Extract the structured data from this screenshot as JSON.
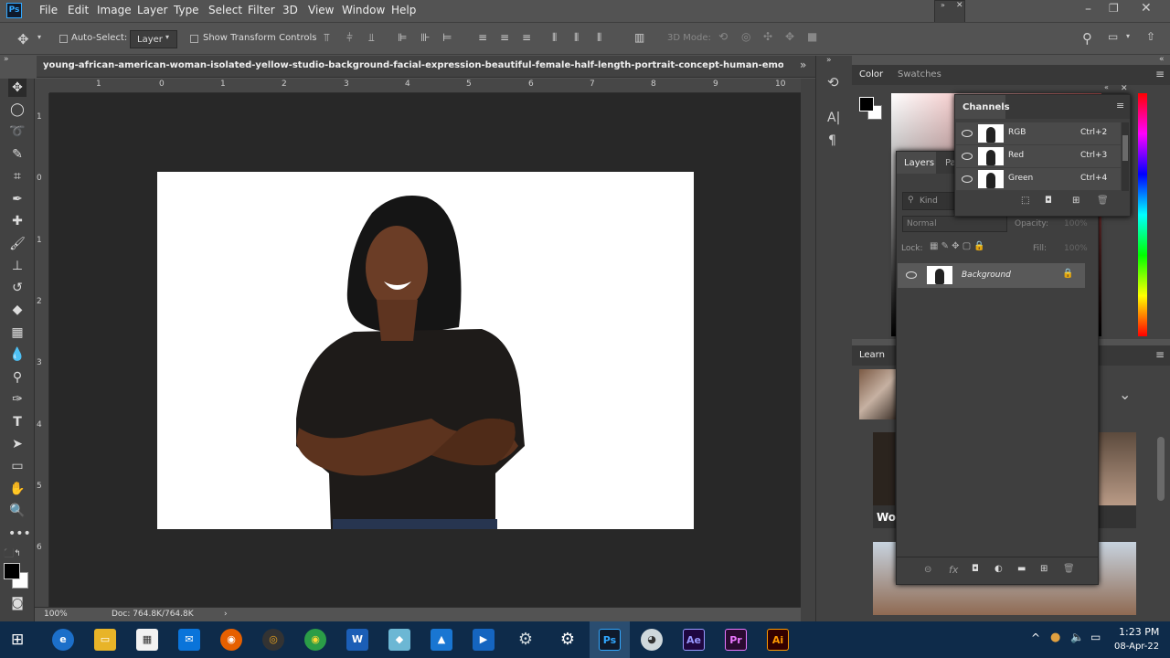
{
  "app": {
    "logo": "Ps",
    "accent": "#31a8ff"
  },
  "menu": [
    "File",
    "Edit",
    "Image",
    "Layer",
    "Type",
    "Select",
    "Filter",
    "3D",
    "View",
    "Window",
    "Help"
  ],
  "options": {
    "auto_select_label": "Auto-Select:",
    "auto_select_value": "Layer",
    "show_transform_label": "Show Transform Controls",
    "mode_3d_label": "3D Mode:"
  },
  "document": {
    "tab_title": "young-african-american-woman-isolated-yellow-studio-background-facial-expression-beautiful-female-half-length-portrait-concept-human-emotions-facial-expressic",
    "zoom": "100%",
    "doc_size": "Doc: 764.8K/764.8K"
  },
  "ruler_top": [
    "1",
    "0",
    "1",
    "2",
    "3",
    "4",
    "5",
    "6",
    "7",
    "8",
    "9",
    "10"
  ],
  "ruler_left": [
    "1",
    "0",
    "1",
    "2",
    "3",
    "4",
    "5",
    "6"
  ],
  "color_panel": {
    "tabs": [
      "Color",
      "Swatches"
    ]
  },
  "learn_panel": {
    "title": "Learn",
    "card_caption": "Wor"
  },
  "layers_panel": {
    "tabs": [
      "Layers",
      "Pa"
    ],
    "kind_placeholder": "Kind",
    "blend_mode": "Normal",
    "opacity_label": "Opacity:",
    "opacity_value": "100%",
    "lock_label": "Lock:",
    "fill_label": "Fill:",
    "fill_value": "100%",
    "layers": [
      {
        "name": "Background"
      }
    ]
  },
  "channels_panel": {
    "title": "Channels",
    "channels": [
      {
        "name": "RGB",
        "shortcut": "Ctrl+2"
      },
      {
        "name": "Red",
        "shortcut": "Ctrl+3"
      },
      {
        "name": "Green",
        "shortcut": "Ctrl+4"
      }
    ]
  },
  "taskbar": {
    "time": "1:23 PM",
    "date": "08-Apr-22",
    "apps": [
      "Ae",
      "Pr",
      "Ai"
    ]
  }
}
